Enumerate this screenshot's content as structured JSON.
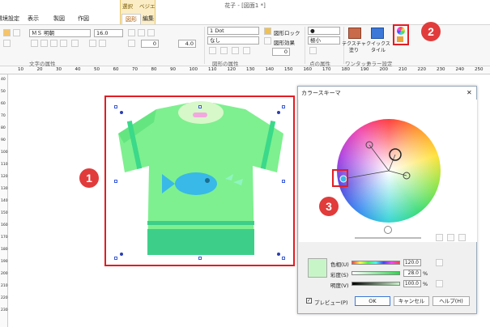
{
  "window": {
    "title": "花子 - [図面1 *]"
  },
  "tabs": [
    {
      "label": "環境設定"
    },
    {
      "label": "表示"
    },
    {
      "label": "製図"
    },
    {
      "label": "作図"
    },
    {
      "label": "図形"
    },
    {
      "label": "編集"
    }
  ],
  "context_tabs": {
    "select": "選択",
    "bezier": "ベジエ"
  },
  "ribbon": {
    "font_name": "ＭＳ 明朝",
    "font_size": "16.0",
    "line_width": "1 Dot",
    "line_style": "なし",
    "spacing_a": "0",
    "spacing_b": "4.0",
    "spacing_c": "0",
    "group_text": "文字の属性",
    "group_shape": "図形の属性",
    "group_point": "点の属性",
    "group_oneshot": "ワンタッチ",
    "group_color": "カラー設定",
    "lock_label": "図形ロック",
    "effect_label": "図形効果",
    "point_size": "極小",
    "texture_label": "テクスチャ塗り",
    "quick_label": "クイックスタイル"
  },
  "ruler": {
    "h_ticks": [
      "10",
      "20",
      "30",
      "40",
      "50",
      "60",
      "70",
      "80",
      "90",
      "100",
      "110",
      "120",
      "130",
      "140",
      "150",
      "160",
      "170",
      "180",
      "190",
      "200",
      "210",
      "220",
      "230",
      "240",
      "250"
    ],
    "v_ticks": [
      "40",
      "50",
      "60",
      "70",
      "80",
      "90",
      "100",
      "110",
      "120",
      "130",
      "140",
      "150",
      "160",
      "170",
      "180",
      "190",
      "200",
      "210",
      "220",
      "230"
    ]
  },
  "callouts": [
    "1",
    "2",
    "3"
  ],
  "dialog": {
    "title": "カラースキーマ",
    "hue_label": "色相(U)",
    "hue_value": "120.0",
    "sat_label": "彩度(S)",
    "sat_value": "28.0",
    "val_label": "明度(V)",
    "val_value": "100.0",
    "percent": "%",
    "preview_label": "プレビュー(P)",
    "ok": "OK",
    "cancel": "キャンセル",
    "help": "ヘルプ(H)"
  },
  "colors": {
    "accent_red": "#e21d24",
    "shirt": "#7ef08f",
    "shirt_dark": "#3bd98a",
    "fish": "#39b9e8",
    "preview_swatch": "#c8f5c8"
  }
}
